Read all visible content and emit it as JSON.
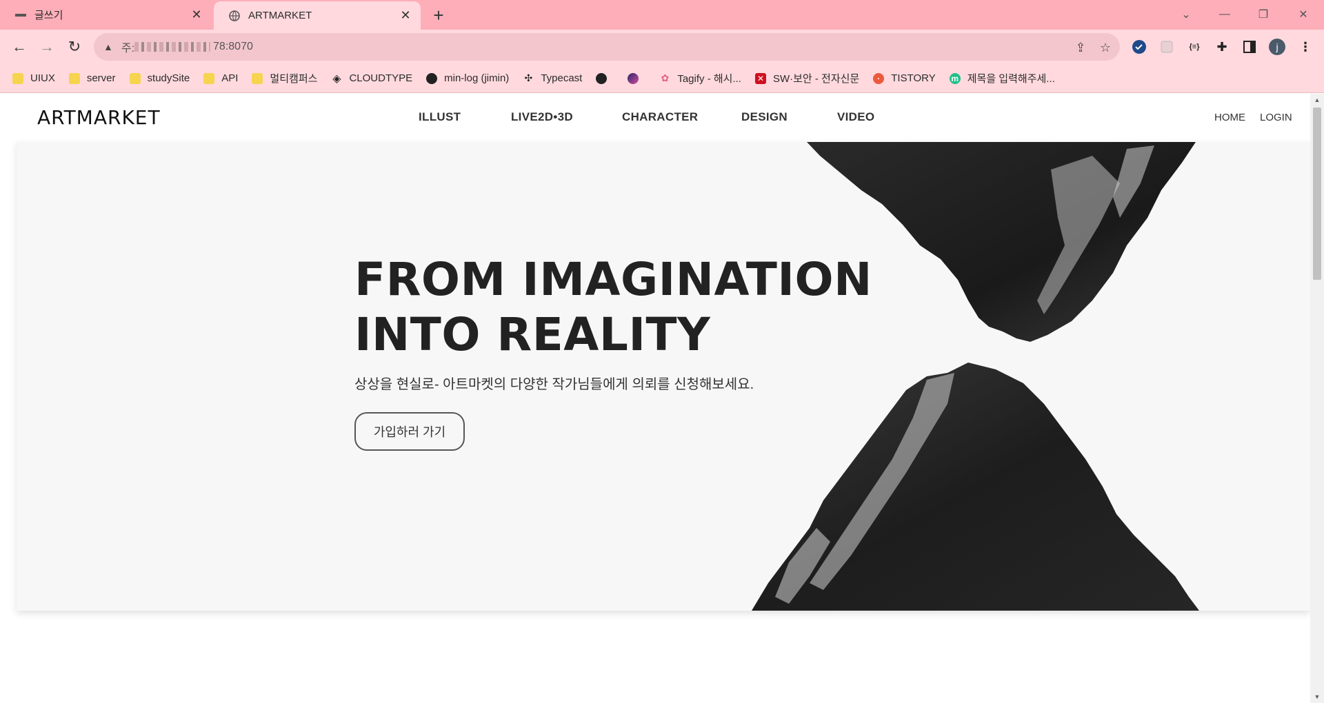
{
  "browser": {
    "tabs": [
      {
        "title": "글쓰기",
        "active": false
      },
      {
        "title": "ARTMARKET",
        "active": true
      }
    ],
    "address": {
      "suffix": "78:8070",
      "prefix_label": "주:"
    },
    "bookmarks": [
      {
        "label": "UIUX",
        "icon": "folder"
      },
      {
        "label": "server",
        "icon": "folder"
      },
      {
        "label": "studySite",
        "icon": "folder"
      },
      {
        "label": "API",
        "icon": "folder"
      },
      {
        "label": "멀티캠퍼스",
        "icon": "folder"
      },
      {
        "label": "CLOUDTYPE",
        "icon": "cloudtype-icon"
      },
      {
        "label": "min-log (jimin)",
        "icon": "github-icon"
      },
      {
        "label": "Typecast",
        "icon": "typecast-icon"
      },
      {
        "label": "",
        "icon": "globe-icon"
      },
      {
        "label": "",
        "icon": "orb-icon"
      },
      {
        "label": "Tagify - 해시...",
        "icon": "tagify-icon"
      },
      {
        "label": "SW·보안 - 전자신문",
        "icon": "etnews-icon"
      },
      {
        "label": "TISTORY",
        "icon": "tistory-icon"
      },
      {
        "label": "제목을 입력해주세...",
        "icon": "m-icon"
      }
    ],
    "profile_initial": "j"
  },
  "site": {
    "logo": "ARTMARKET",
    "nav": [
      "ILLUST",
      "LIVE2D•3D",
      "CHARACTER",
      "DESIGN",
      "VIDEO"
    ],
    "util": {
      "home": "HOME",
      "login": "LOGIN"
    }
  },
  "hero": {
    "title_line1": "FROM IMAGINATION",
    "title_line2": "INTO REALITY",
    "subtitle": "상상을 현실로- 아트마켓의 다양한 작가님들에게 의뢰를 신청해보세요.",
    "cta": "가입하러 가기"
  }
}
